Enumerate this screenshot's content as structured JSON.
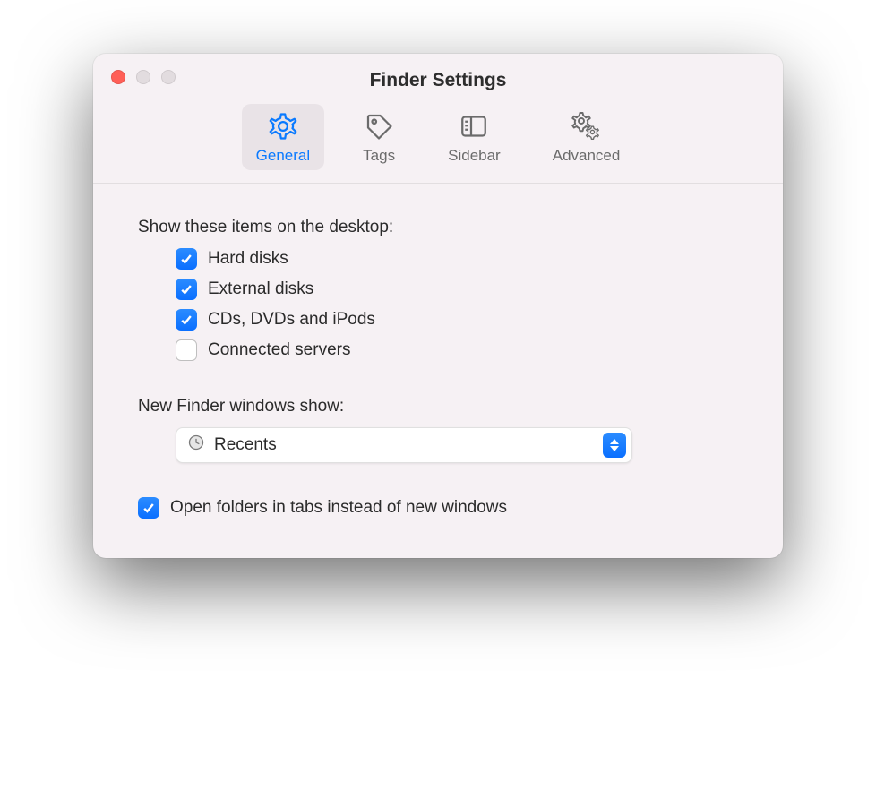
{
  "window": {
    "title": "Finder Settings"
  },
  "tabs": {
    "general": {
      "label": "General",
      "active": true
    },
    "tags": {
      "label": "Tags",
      "active": false
    },
    "sidebar": {
      "label": "Sidebar",
      "active": false
    },
    "advanced": {
      "label": "Advanced",
      "active": false
    }
  },
  "sections": {
    "desktop_items": {
      "heading": "Show these items on the desktop:",
      "items": [
        {
          "label": "Hard disks",
          "checked": true
        },
        {
          "label": "External disks",
          "checked": true
        },
        {
          "label": "CDs, DVDs and iPods",
          "checked": true
        },
        {
          "label": "Connected servers",
          "checked": false
        }
      ]
    },
    "new_windows": {
      "heading": "New Finder windows show:",
      "selected": "Recents"
    },
    "open_in_tabs": {
      "label": "Open folders in tabs instead of new windows",
      "checked": true
    }
  }
}
